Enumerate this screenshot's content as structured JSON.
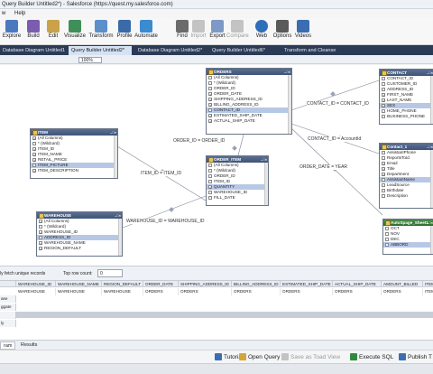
{
  "window": {
    "title": "Query Builder Untitled2*) - Salesforce (https://quest.my.salesforce.com)"
  },
  "menu": {
    "items": [
      "w",
      "Help"
    ]
  },
  "ribbon": {
    "buttons": [
      {
        "label": "Explore",
        "icon": "explore-icon",
        "color": "#4a79c0"
      },
      {
        "label": "Build",
        "icon": "build-icon",
        "color": "#7a5cb0"
      },
      {
        "label": "Edit",
        "icon": "edit-icon",
        "color": "#c9a24a"
      },
      {
        "label": "Visualize",
        "icon": "visualize-icon",
        "color": "#3e8f5a"
      },
      {
        "label": "Transform",
        "icon": "transform-icon",
        "color": "#5b8fc9"
      },
      {
        "label": "Profile",
        "icon": "profile-icon",
        "color": "#3a6aa8"
      },
      {
        "label": "Automate",
        "icon": "automate-icon",
        "color": "#3a8bd0"
      },
      {
        "label": "Find",
        "icon": "find-icon",
        "color": "#6b6b6b"
      },
      {
        "label": "Import",
        "icon": "import-icon",
        "color": "#9a9a9a"
      },
      {
        "label": "Export",
        "icon": "export-icon",
        "color": "#9a9a9a"
      },
      {
        "label": "Compare",
        "icon": "compare-icon",
        "color": "#9a9a9a"
      },
      {
        "label": "Web",
        "icon": "web-icon",
        "color": "#2d6fb8"
      },
      {
        "label": "Options",
        "icon": "options-icon",
        "color": "#5a5a5a"
      },
      {
        "label": "Videos",
        "icon": "videos-icon",
        "color": "#3b6db1"
      }
    ]
  },
  "tabs": [
    {
      "label": "Database Diagram Untitled1*"
    },
    {
      "label": "Query Builder Untitled2*"
    },
    {
      "label": "Database Diagram Untitled2*"
    },
    {
      "label": "Query Builder Untitled6*"
    },
    {
      "label": "Transform and Cleanse"
    }
  ],
  "toolbar": {
    "zoom": "100%"
  },
  "tables": {
    "orders": {
      "title": "ORDERS",
      "rows": [
        "(All Columns)",
        "* (Wildcard)",
        "ORDER_ID",
        "ORDER_DATE",
        "SHIPPING_ADDRESS_ID",
        "BILLING_ADDRESS_ID",
        "CONTACT_ID",
        "ESTIMATED_SHIP_DATE",
        "ACTUAL_SHIP_DATE"
      ],
      "checked": [
        false,
        false,
        false,
        true,
        true,
        true,
        false,
        true,
        true
      ],
      "selected": 6
    },
    "contact": {
      "title": "CONTACT",
      "rows": [
        "CONTACT_ID",
        "CUSTOMER_ID",
        "ADDRESS_ID",
        "FIRST_NAME",
        "LAST_NAME",
        "SEX",
        "HOME_PHONE",
        "BUSINESS_PHONE"
      ],
      "checked": [
        false,
        false,
        false,
        true,
        true,
        true,
        false,
        false
      ],
      "selected": 5
    },
    "item": {
      "title": "ITEM",
      "rows": [
        "(All Columns)",
        "* (Wildcard)",
        "ITEM_ID",
        "ITEM_NAME",
        "RETAIL_PRICE",
        "ITEM_PICTURE",
        "ITEM_DESCRIPTION"
      ],
      "checked": [
        true,
        false,
        true,
        true,
        true,
        false,
        true
      ],
      "selected": 5
    },
    "order_item": {
      "title": "ORDER_ITEM",
      "rows": [
        "(All Columns)",
        "* (Wildcard)",
        "ORDER_ID",
        "ITEM_ID",
        "QUANTITY",
        "WAREHOUSE_ID",
        "FILL_DATE"
      ],
      "checked": [
        false,
        false,
        false,
        false,
        true,
        false,
        false
      ],
      "selected": 4
    },
    "warehouse": {
      "title": "WAREHOUSE",
      "rows": [
        "(All Columns)",
        "* (Wildcard)",
        "WAREHOUSE_ID",
        "ADDRESS_ID",
        "WAREHOUSE_NAME",
        "REGION_DEFAULT"
      ],
      "checked": [
        true,
        false,
        true,
        false,
        true,
        true
      ],
      "selected": 3
    },
    "contact1": {
      "title": "Contact_1",
      "rows": [
        "AssistantPhone",
        "ReportsToId",
        "Email",
        "Title",
        "Department",
        "AssistantName",
        "LeadSource",
        "Birthdate",
        "Description"
      ],
      "checked": [
        false,
        false,
        true,
        true,
        true,
        false,
        false,
        false,
        false
      ],
      "selected": 5
    },
    "autospage": {
      "title": "AutoSpage_Sheet1",
      "rows": [
        "OCT",
        "NOV",
        "DEC",
        "ABBORD"
      ],
      "checked": [
        false,
        false,
        false,
        false
      ],
      "selected": 3
    }
  },
  "relations": [
    {
      "label": "CONTACT_ID = CONTACT_ID"
    },
    {
      "label": "ORDER_ID = ORDER_ID"
    },
    {
      "label": "CONTACT_ID = AccountId"
    },
    {
      "label": "ORDER_DATE = YEAR"
    },
    {
      "label": "ITEM_ID = ITEM_ID"
    },
    {
      "label": "WAREHOUSE_ID = WAREHOUSE_ID"
    }
  ],
  "midbar": {
    "fetch_label": "ly fetch unique records",
    "top_row_label": "Top row count:",
    "top_row_value": "0"
  },
  "grid": {
    "columns": [
      "WAREHOUSE_ID",
      "WAREHOUSE_NAME",
      "REGION_DEFAULT",
      "ORDER_DATE",
      "SHIPPING_ADDRESS_ID",
      "BILLING_ADDRESS_ID",
      "ESTIMATED_SHIP_DATE",
      "ACTUAL_SHIP_DATE",
      "AMOUNT_BILLED",
      "ITEM"
    ],
    "row_labels": [
      "ase",
      "ggate",
      "",
      "ly"
    ],
    "table_row": [
      "WAREHOUSE",
      "WAREHOUSE",
      "WAREHOUSE",
      "ORDERS",
      "ORDERS",
      "ORDERS",
      "ORDERS",
      "ORDERS",
      "ORDERS",
      "ITEM"
    ]
  },
  "bottom_tabs": [
    "ram",
    "Results"
  ],
  "actions": [
    {
      "label": "Tutorial",
      "icon": "tutorial-icon",
      "color": "#3b6db1"
    },
    {
      "label": "Open Query",
      "icon": "open-query-icon",
      "color": "#d4a53a"
    },
    {
      "label": "Save as Toad View",
      "icon": "save-toad-view-icon",
      "color": "#9a9a9a"
    },
    {
      "label": "Execute SQL",
      "icon": "execute-sql-icon",
      "color": "#2e8b3e"
    },
    {
      "label": "Publish T",
      "icon": "publish-icon",
      "color": "#3b6db1"
    }
  ]
}
